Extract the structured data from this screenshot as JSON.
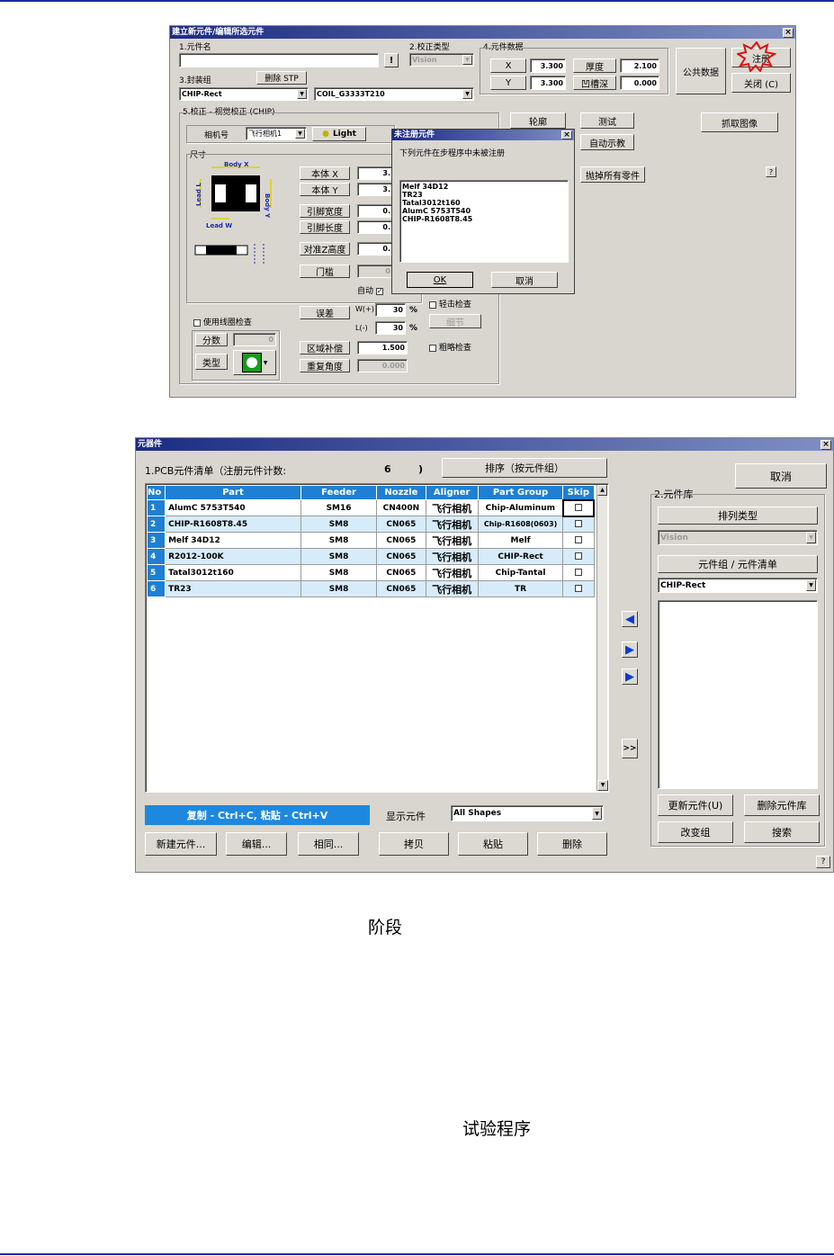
{
  "top_window": {
    "title": "建立新元件/编辑所选元件",
    "s1_label": "1.元件名",
    "s1_btn": "!",
    "s2_label": "2.校正类型",
    "s2_value": "Vision",
    "s4_label": "4.元件数据",
    "x_label": "X",
    "x_value": "3.300",
    "y_label": "Y",
    "y_value": "3.300",
    "thickness_label": "厚度",
    "thickness_value": "2.100",
    "recess_label": "凹槽深",
    "recess_value": "0.000",
    "common_btn": "公共数据",
    "register_btn": "注册",
    "close_btn": "关闭 (C)",
    "s3_label": "3.封装组",
    "delete_stp_btn": "删除 STP",
    "package_value": "CHIP-Rect",
    "coil_value": "COIL_G3333T210",
    "s5_label": "5.校正 - 视觉校正 (CHIP)",
    "teach_btn": "轮廓",
    "test_btn": "测试",
    "auto_teach_btn": "自动示教",
    "grab_btn": "抓取图像",
    "discard_btn": "抛掉所有零件",
    "help_btn": "?",
    "camera_label": "相机号",
    "camera_value": "飞行相机1",
    "light_btn": "Light",
    "size_label": "尺寸",
    "body_x_diagram": "Body X",
    "body_y_diagram": "Body Y",
    "lead_l_diagram": "Lead L",
    "lead_w_diagram": "Lead W",
    "body_x_label": "本体 X",
    "body_x_value": "3.",
    "body_y_label": "本体 Y",
    "body_y_value": "3.",
    "lead_w_label": "引脚宽度",
    "lead_w_value": "0.",
    "lead_l_label": "引脚长度",
    "lead_l_value": "0.",
    "z_label": "对准Z高度",
    "z_value": "0.",
    "threshold_label": "门槛",
    "threshold_value": "0",
    "auto_label": "自动",
    "tolerance_label": "误差",
    "tol_w_label": "W(+)",
    "tol_w_value": "30",
    "tol_w_unit": "%",
    "tol_l_label": "L(-)",
    "tol_l_value": "30",
    "tol_l_unit": "%",
    "light_check_label": "轻击检查",
    "detail_btn": "细节",
    "use_coil_label": "使用线圈检查",
    "score_label": "分数",
    "score_value": "0",
    "type_label": "类型",
    "region_label": "区域补偿",
    "region_value": "1.500",
    "repeat_label": "重复角度",
    "repeat_value": "0.000",
    "rough_label": "粗略检查",
    "popup": {
      "title": "未注册元件",
      "message": "下列元件在步程序中未被注册",
      "items": [
        "Melf 34D12",
        "TR23",
        "Tatal3012t160",
        "AlumC 5753T540",
        "CHIP-R1608T8.45"
      ],
      "ok_btn": "OK",
      "cancel_btn": "取消"
    }
  },
  "bottom_window": {
    "title": "元器件",
    "list_label": "1.PCB元件清单（注册元件计数:",
    "count": "6",
    "count_close": ")",
    "sort_btn": "排序（按元件组）",
    "cancel_btn": "取消",
    "columns": [
      "No",
      "Part",
      "Feeder",
      "Nozzle",
      "Aligner",
      "Part Group",
      "Skip"
    ],
    "rows": [
      {
        "no": "1",
        "part": "AlumC 5753T540",
        "feeder": "SM16",
        "nozzle": "CN400N",
        "aligner": "飞行相机",
        "group": "Chip-Aluminum"
      },
      {
        "no": "2",
        "part": "CHIP-R1608T8.45",
        "feeder": "SM8",
        "nozzle": "CN065",
        "aligner": "飞行相机",
        "group": "Chip-R1608(0603)"
      },
      {
        "no": "3",
        "part": "Melf 34D12",
        "feeder": "SM8",
        "nozzle": "CN065",
        "aligner": "飞行相机",
        "group": "Melf"
      },
      {
        "no": "4",
        "part": "R2012-100K",
        "feeder": "SM8",
        "nozzle": "CN065",
        "aligner": "飞行相机",
        "group": "CHIP-Rect"
      },
      {
        "no": "5",
        "part": "Tatal3012t160",
        "feeder": "SM8",
        "nozzle": "CN065",
        "aligner": "飞行相机",
        "group": "Chip-Tantal"
      },
      {
        "no": "6",
        "part": "TR23",
        "feeder": "SM8",
        "nozzle": "CN065",
        "aligner": "飞行相机",
        "group": "TR"
      }
    ],
    "lib_label": "2.元件库",
    "sort_type_btn": "排列类型",
    "sort_type_value": "Vision",
    "group_list_btn": "元件组 / 元件清单",
    "group_value": "CHIP-Rect",
    "more_btn": ">>",
    "copy_paste_hint": "复制 - Ctrl+C, 粘贴 - Ctrl+V",
    "show_label": "显示元件",
    "show_value": "All Shapes",
    "new_btn": "新建元件...",
    "edit_btn": "编辑...",
    "same_btn": "相同...",
    "copy_btn": "拷贝",
    "paste_btn": "粘贴",
    "delete_btn": "删除",
    "update_lib_btn": "更新元件(U)",
    "delete_lib_btn": "删除元件库",
    "change_group_btn": "改变组",
    "search_btn": "搜索",
    "help_btn": "?"
  },
  "doc": {
    "caption1": "阶段",
    "caption2": "试验程序"
  }
}
